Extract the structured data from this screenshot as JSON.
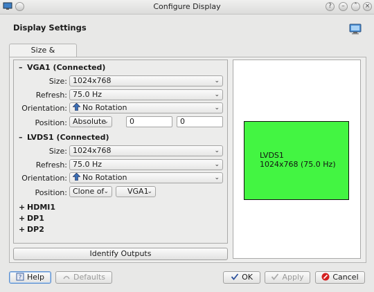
{
  "window": {
    "title": "Configure Display"
  },
  "header": {
    "title": "Display Settings"
  },
  "tabs": [
    {
      "label": "Size & Orientation"
    }
  ],
  "outputs": [
    {
      "sign": "–",
      "name": "VGA1 (Connected)",
      "expanded": true,
      "size_label": "Size:",
      "size": "1024x768",
      "refresh_label": "Refresh:",
      "refresh": "75.0 Hz",
      "orientation_label": "Orientation:",
      "orientation": "No Rotation",
      "position_label": "Position:",
      "position_mode": "Absolute",
      "pos_x": "0",
      "pos_y": "0"
    },
    {
      "sign": "–",
      "name": "LVDS1 (Connected)",
      "expanded": true,
      "size_label": "Size:",
      "size": "1024x768",
      "refresh_label": "Refresh:",
      "refresh": "75.0 Hz",
      "orientation_label": "Orientation:",
      "orientation": "No Rotation",
      "position_label": "Position:",
      "position_mode": "Clone of",
      "clone_target": "VGA1"
    },
    {
      "sign": "+",
      "name": "HDMI1",
      "expanded": false
    },
    {
      "sign": "+",
      "name": "DP1",
      "expanded": false
    },
    {
      "sign": "+",
      "name": "DP2",
      "expanded": false
    }
  ],
  "identify_button": "Identify Outputs",
  "preview": {
    "screen_name": "LVDS1",
    "screen_mode": "1024x768 (75.0 Hz)",
    "screen_color": "#43f542"
  },
  "footer": {
    "help": "Help",
    "defaults": "Defaults",
    "ok": "OK",
    "apply": "Apply",
    "cancel": "Cancel"
  },
  "colors": {
    "help_border": "#5b8fcf",
    "cancel_icon": "#d42020",
    "ok_icon": "#2a4f9b"
  }
}
